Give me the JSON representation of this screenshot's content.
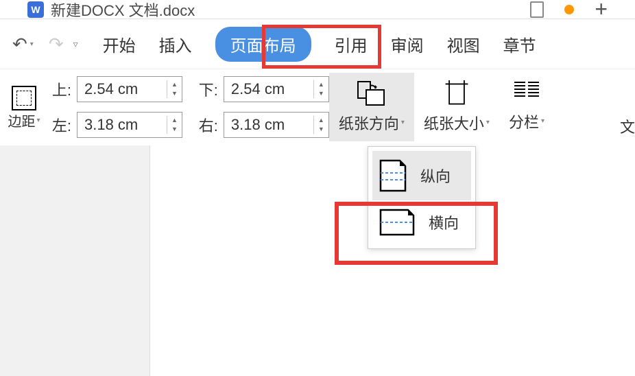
{
  "titlebar": {
    "doc_icon_letter": "W",
    "title": "新建DOCX 文档.docx"
  },
  "tabs": {
    "start": "开始",
    "insert": "插入",
    "layout": "页面布局",
    "reference": "引用",
    "review": "审阅",
    "view": "视图",
    "chapter": "章节"
  },
  "margins": {
    "button_label": "边距",
    "top_label": "上:",
    "bottom_label": "下:",
    "left_label": "左:",
    "right_label": "右:",
    "top_value": "2.54 cm",
    "bottom_value": "2.54 cm",
    "left_value": "3.18 cm",
    "right_value": "3.18 cm"
  },
  "ribbon": {
    "orientation_label": "纸张方向",
    "size_label": "纸张大小",
    "columns_label": "分栏",
    "text_direction_partial": "文"
  },
  "dropdown": {
    "portrait": "纵向",
    "landscape": "横向"
  }
}
